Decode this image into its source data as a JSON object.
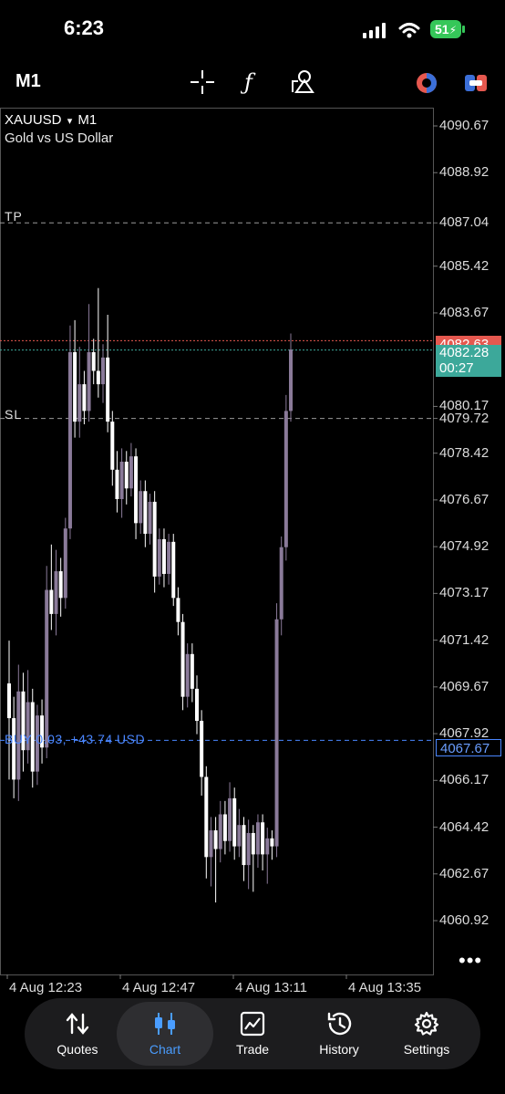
{
  "status_bar": {
    "time": "6:23",
    "battery": "51"
  },
  "toolbar": {
    "timeframe": "M1",
    "icons": [
      "crosshair-icon",
      "indicator-f-icon",
      "objects-icon",
      "trading-signal-icon",
      "one-click-trading-icon"
    ]
  },
  "chart": {
    "symbol": "XAUUSD",
    "symbol_arrow": "▾",
    "timeframe": "M1",
    "description": "Gold vs US Dollar",
    "tp_label": "TP",
    "sl_label": "SL",
    "buy_label": "BUY 0.03, +43.74 USD",
    "ask_price": "4082.63",
    "bid_price": "4082.28",
    "countdown": "00:27",
    "buy_price": "4067.67",
    "more": "•••",
    "colors": {
      "ask": "#e5584f",
      "bid": "#3ca89a",
      "position": "#4a86ff",
      "candle_up": "#8a7a99",
      "candle_down": "#ffffff"
    }
  },
  "chart_data": {
    "type": "candlestick",
    "y_ticks": [
      "4090.67",
      "4088.92",
      "4087.04",
      "4085.42",
      "4083.67",
      "4080.17",
      "4079.72",
      "4078.42",
      "4076.67",
      "4074.92",
      "4073.17",
      "4071.42",
      "4069.67",
      "4067.92",
      "4066.17",
      "4064.42",
      "4062.67",
      "4060.92"
    ],
    "x_ticks": [
      "4 Aug 12:23",
      "4 Aug 12:47",
      "4 Aug 13:11",
      "4 Aug 13:35"
    ],
    "ylim": [
      4059.5,
      4091.5
    ],
    "lines": {
      "tp": 4087.04,
      "sl": 4079.72,
      "ask": 4082.63,
      "bid": 4082.28,
      "position": 4067.67
    },
    "candles": [
      [
        4069.8,
        4068.5,
        4071.4,
        4066.2
      ],
      [
        4068.5,
        4066.2,
        4069.3,
        4065.5
      ],
      [
        4066.2,
        4069.5,
        4070.5,
        4065.4
      ],
      [
        4069.5,
        4067.3,
        4070.2,
        4066.5
      ],
      [
        4067.3,
        4069.1,
        4070.3,
        4066.8
      ],
      [
        4069.1,
        4066.5,
        4069.6,
        4065.9
      ],
      [
        4066.5,
        4068.6,
        4069.0,
        4066.0
      ],
      [
        4068.6,
        4067.4,
        4069.2,
        4066.8
      ],
      [
        4067.4,
        4073.3,
        4074.2,
        4067.0
      ],
      [
        4073.3,
        4072.4,
        4075.0,
        4071.8
      ],
      [
        4072.4,
        4074.0,
        4074.8,
        4071.6
      ],
      [
        4074.0,
        4073.0,
        4074.5,
        4072.3
      ],
      [
        4073.0,
        4075.6,
        4076.0,
        4072.6
      ],
      [
        4075.6,
        4082.2,
        4083.2,
        4075.2
      ],
      [
        4082.2,
        4079.6,
        4083.4,
        4079.0
      ],
      [
        4079.6,
        4081.0,
        4082.4,
        4079.0
      ],
      [
        4081.0,
        4080.0,
        4081.5,
        4079.5
      ],
      [
        4080.0,
        4082.2,
        4084.0,
        4079.6
      ],
      [
        4082.2,
        4081.5,
        4082.7,
        4081.0
      ],
      [
        4081.5,
        4081.0,
        4084.6,
        4080.5
      ],
      [
        4081.0,
        4082.0,
        4082.5,
        4080.3
      ],
      [
        4082.0,
        4079.6,
        4083.6,
        4079.2
      ],
      [
        4079.6,
        4077.8,
        4080.0,
        4077.2
      ],
      [
        4077.8,
        4076.7,
        4078.5,
        4076.2
      ],
      [
        4076.7,
        4078.1,
        4078.6,
        4076.0
      ],
      [
        4078.1,
        4077.1,
        4078.5,
        4076.5
      ],
      [
        4077.1,
        4078.3,
        4078.8,
        4076.8
      ],
      [
        4078.3,
        4075.8,
        4078.6,
        4075.2
      ],
      [
        4075.8,
        4077.0,
        4077.4,
        4075.4
      ],
      [
        4077.0,
        4075.4,
        4077.4,
        4074.9
      ],
      [
        4075.4,
        4076.6,
        4076.9,
        4075.0
      ],
      [
        4076.6,
        4073.8,
        4077.0,
        4073.2
      ],
      [
        4073.8,
        4075.2,
        4075.6,
        4073.5
      ],
      [
        4075.2,
        4073.9,
        4075.6,
        4073.4
      ],
      [
        4073.9,
        4075.1,
        4075.4,
        4073.5
      ],
      [
        4075.1,
        4073.0,
        4075.4,
        4072.7
      ],
      [
        4073.0,
        4072.1,
        4073.4,
        4071.6
      ],
      [
        4072.1,
        4069.3,
        4072.4,
        4068.8
      ],
      [
        4069.3,
        4070.9,
        4071.3,
        4068.9
      ],
      [
        4070.9,
        4069.6,
        4071.3,
        4069.1
      ],
      [
        4069.6,
        4068.4,
        4070.1,
        4067.9
      ],
      [
        4068.4,
        4066.3,
        4068.8,
        4065.6
      ],
      [
        4066.3,
        4063.3,
        4066.7,
        4062.5
      ],
      [
        4063.3,
        4064.3,
        4064.8,
        4062.2
      ],
      [
        4064.3,
        4063.6,
        4064.8,
        4061.6
      ],
      [
        4063.6,
        4064.9,
        4065.4,
        4063.1
      ],
      [
        4064.9,
        4063.9,
        4065.4,
        4063.4
      ],
      [
        4063.9,
        4065.5,
        4066.1,
        4063.5
      ],
      [
        4065.5,
        4063.7,
        4065.9,
        4063.2
      ],
      [
        4063.7,
        4064.5,
        4065.1,
        4063.3
      ],
      [
        4064.5,
        4063.0,
        4064.8,
        4062.4
      ],
      [
        4063.0,
        4064.2,
        4064.7,
        4062.1
      ],
      [
        4064.2,
        4063.4,
        4064.5,
        4062.0
      ],
      [
        4063.4,
        4064.6,
        4064.9,
        4062.9
      ],
      [
        4064.6,
        4063.4,
        4064.9,
        4062.8
      ],
      [
        4063.4,
        4064.0,
        4064.4,
        4062.3
      ],
      [
        4064.0,
        4063.7,
        4064.3,
        4063.2
      ],
      [
        4063.7,
        4072.2,
        4072.8,
        4063.3
      ],
      [
        4072.2,
        4074.9,
        4075.3,
        4071.6
      ],
      [
        4074.9,
        4080.0,
        4080.6,
        4074.4
      ],
      [
        4080.0,
        4082.3,
        4082.9,
        4079.6
      ]
    ]
  },
  "bottom_nav": {
    "items": [
      {
        "label": "Quotes",
        "icon": "quotes-arrows-icon"
      },
      {
        "label": "Chart",
        "icon": "chart-candles-icon",
        "active": true
      },
      {
        "label": "Trade",
        "icon": "trade-chart-icon"
      },
      {
        "label": "History",
        "icon": "history-clock-icon"
      },
      {
        "label": "Settings",
        "icon": "settings-gear-icon"
      }
    ]
  }
}
